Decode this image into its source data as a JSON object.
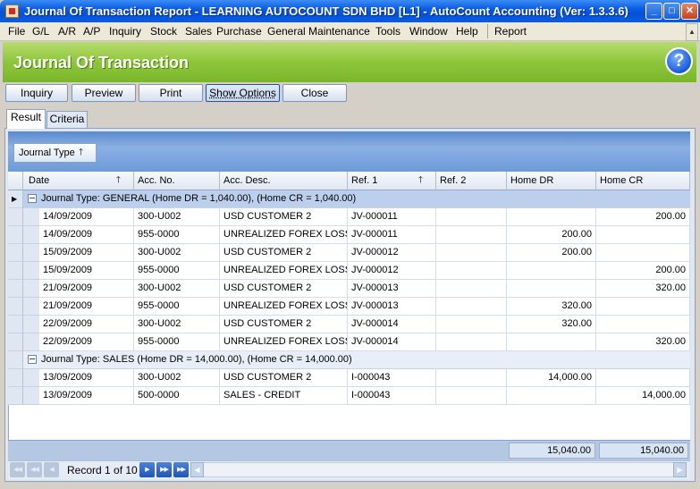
{
  "window": {
    "title": "Journal Of Transaction Report - LEARNING AUTOCOUNT SDN BHD [L1] - AutoCount Accounting (Ver: 1.3.3.6)"
  },
  "menu": [
    {
      "label": "File"
    },
    {
      "label": "G/L"
    },
    {
      "label": "A/R"
    },
    {
      "label": "A/P"
    },
    {
      "label": "Inquiry"
    },
    {
      "label": "Stock"
    },
    {
      "label": "Sales"
    },
    {
      "label": "Purchase"
    },
    {
      "label": "General Maintenance"
    },
    {
      "label": "Tools"
    },
    {
      "label": "Window"
    },
    {
      "label": "Help"
    },
    {
      "label": "Report"
    }
  ],
  "header": {
    "title": "Journal Of Transaction"
  },
  "toolbar": {
    "inquiry": "Inquiry",
    "preview": "Preview",
    "print": "Print",
    "show_options": "Show Options",
    "close": "Close"
  },
  "tabs": {
    "result": "Result",
    "criteria": "Criteria"
  },
  "group_by": {
    "chip": "Journal Type"
  },
  "columns": {
    "date": "Date",
    "acc_no": "Acc. No.",
    "acc_desc": "Acc. Desc.",
    "ref1": "Ref. 1",
    "ref2": "Ref. 2",
    "home_dr": "Home DR",
    "home_cr": "Home CR"
  },
  "groups": [
    {
      "label": "Journal Type: GENERAL (Home DR = 1,040.00), (Home CR = 1,040.00)",
      "rows": [
        {
          "date": "14/09/2009",
          "acc_no": "300-U002",
          "acc_desc": "USD CUSTOMER 2",
          "ref1": "JV-000011",
          "ref2": "",
          "home_dr": "",
          "home_cr": "200.00"
        },
        {
          "date": "14/09/2009",
          "acc_no": "955-0000",
          "acc_desc": "UNREALIZED  FOREX LOSS",
          "ref1": "JV-000011",
          "ref2": "",
          "home_dr": "200.00",
          "home_cr": ""
        },
        {
          "date": "15/09/2009",
          "acc_no": "300-U002",
          "acc_desc": "USD CUSTOMER 2",
          "ref1": "JV-000012",
          "ref2": "",
          "home_dr": "200.00",
          "home_cr": ""
        },
        {
          "date": "15/09/2009",
          "acc_no": "955-0000",
          "acc_desc": "UNREALIZED  FOREX LOSS",
          "ref1": "JV-000012",
          "ref2": "",
          "home_dr": "",
          "home_cr": "200.00"
        },
        {
          "date": "21/09/2009",
          "acc_no": "300-U002",
          "acc_desc": "USD CUSTOMER 2",
          "ref1": "JV-000013",
          "ref2": "",
          "home_dr": "",
          "home_cr": "320.00"
        },
        {
          "date": "21/09/2009",
          "acc_no": "955-0000",
          "acc_desc": "UNREALIZED  FOREX LOSS",
          "ref1": "JV-000013",
          "ref2": "",
          "home_dr": "320.00",
          "home_cr": ""
        },
        {
          "date": "22/09/2009",
          "acc_no": "300-U002",
          "acc_desc": "USD CUSTOMER 2",
          "ref1": "JV-000014",
          "ref2": "",
          "home_dr": "320.00",
          "home_cr": ""
        },
        {
          "date": "22/09/2009",
          "acc_no": "955-0000",
          "acc_desc": "UNREALIZED  FOREX LOSS",
          "ref1": "JV-000014",
          "ref2": "",
          "home_dr": "",
          "home_cr": "320.00"
        }
      ]
    },
    {
      "label": "Journal Type: SALES (Home DR = 14,000.00), (Home CR = 14,000.00)",
      "rows": [
        {
          "date": "13/09/2009",
          "acc_no": "300-U002",
          "acc_desc": "USD CUSTOMER 2",
          "ref1": "I-000043",
          "ref2": "",
          "home_dr": "14,000.00",
          "home_cr": ""
        },
        {
          "date": "13/09/2009",
          "acc_no": "500-0000",
          "acc_desc": "SALES - CREDIT",
          "ref1": "I-000043",
          "ref2": "",
          "home_dr": "",
          "home_cr": "14,000.00"
        }
      ]
    }
  ],
  "totals": {
    "home_dr": "15,040.00",
    "home_cr": "15,040.00"
  },
  "navigator": {
    "record_text": "Record 1 of 10"
  }
}
